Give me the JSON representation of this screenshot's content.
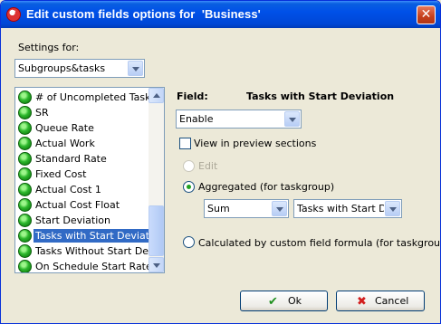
{
  "window": {
    "title": "Edit custom fields options for  'Business'",
    "close_label": "✕"
  },
  "settings": {
    "label": "Settings for:",
    "selected": "Subgroups&tasks"
  },
  "list": {
    "items": [
      {
        "label": "# of Uncompleted Tasks"
      },
      {
        "label": "SR"
      },
      {
        "label": "Queue Rate"
      },
      {
        "label": "Actual Work"
      },
      {
        "label": "Standard Rate"
      },
      {
        "label": "Fixed Cost"
      },
      {
        "label": "Actual Cost 1"
      },
      {
        "label": "Actual Cost Float"
      },
      {
        "label": "Start Deviation"
      },
      {
        "label": "Tasks with Start Deviation"
      },
      {
        "label": "Tasks Without Start Deviation"
      },
      {
        "label": "On Schedule Start Rate"
      }
    ],
    "selected_index": 9
  },
  "field": {
    "label": "Field:",
    "name": "Tasks with Start Deviation",
    "state_selected": "Enable",
    "view_in_preview_label": "View in preview sections",
    "view_in_preview_checked": false,
    "edit_label": "Edit",
    "aggregated_label": "Aggregated (for taskgroup)",
    "aggregate_function": "Sum",
    "aggregate_field": "Tasks with Start Deviation",
    "formula_label": "Calculated by custom field formula (for taskgroup)"
  },
  "buttons": {
    "ok_label": "Ok",
    "cancel_label": "Cancel"
  },
  "colors": {
    "titlebar": "#0050e8",
    "selection": "#316ac5",
    "dialog_bg": "#ece9d8"
  }
}
